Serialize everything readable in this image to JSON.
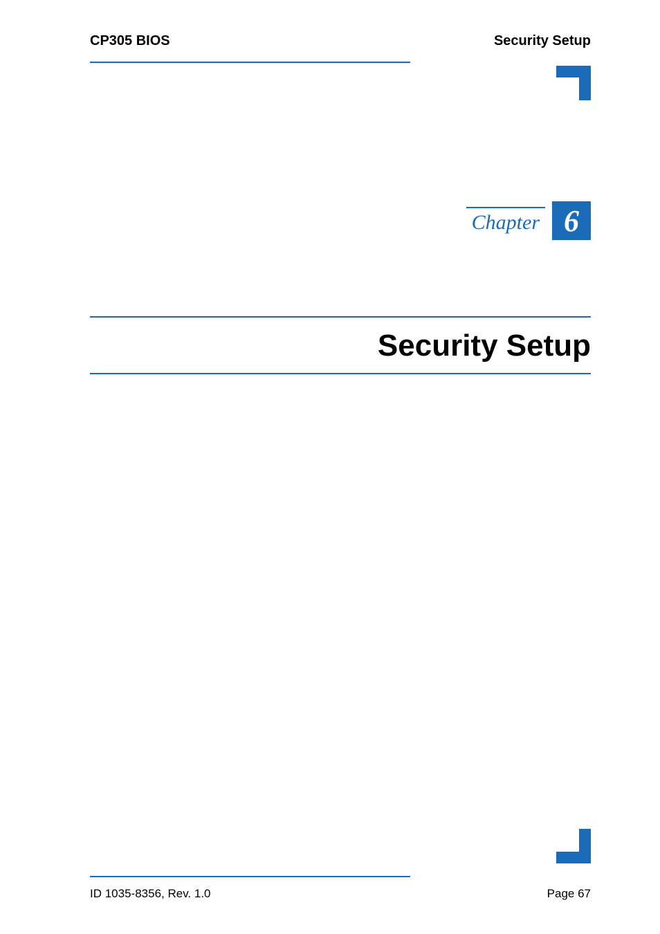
{
  "header": {
    "left": "CP305 BIOS",
    "right": "Security Setup"
  },
  "chapter": {
    "label": "Chapter",
    "number": "6"
  },
  "title": "Security Setup",
  "footer": {
    "id": "ID 1035-8356, Rev. 1.0",
    "page": "Page 67"
  },
  "colors": {
    "accent": "#1a6bb8"
  }
}
